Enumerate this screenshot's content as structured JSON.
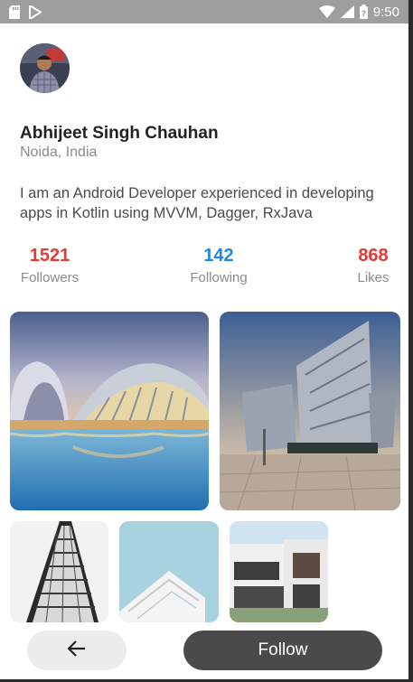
{
  "status_bar": {
    "time": "9:50",
    "icons": [
      "sd-card-icon",
      "play-store-icon",
      "wifi-icon",
      "signal-icon",
      "battery-icon"
    ],
    "background": "#9e9e9e"
  },
  "profile": {
    "name": "Abhijeet Singh Chauhan",
    "location": "Noida, India",
    "bio": "I am an Android Developer experienced in developing apps in Kotlin using MVVM, Dagger, RxJava"
  },
  "stats": {
    "followers": {
      "value": "1521",
      "label": "Followers",
      "color": "#e53935"
    },
    "following": {
      "value": "142",
      "label": "Following",
      "color": "#1e88e5"
    },
    "likes": {
      "value": "868",
      "label": "Likes",
      "color": "#e53935"
    }
  },
  "photos": [
    "architecture-photo",
    "building-photo",
    "tower-photo",
    "balcony-photo",
    "house-photo"
  ],
  "actions": {
    "back_icon": "arrow-back-icon",
    "follow_label": "Follow"
  }
}
